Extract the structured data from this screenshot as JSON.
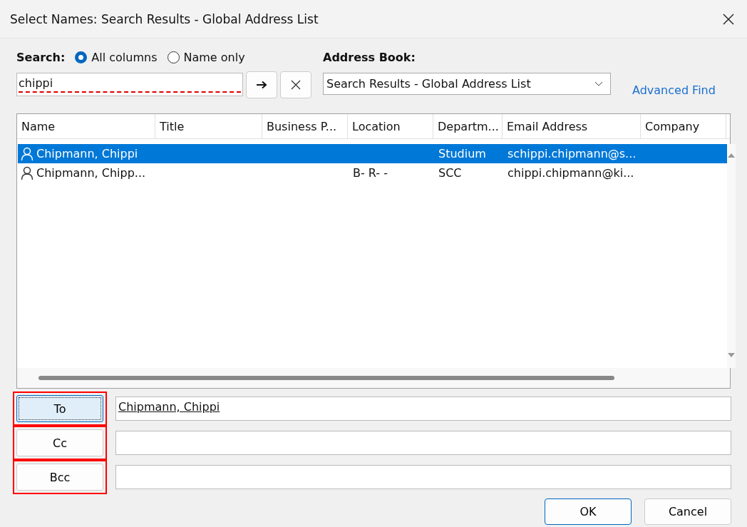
{
  "window": {
    "title": "Select Names: Search Results - Global Address List"
  },
  "search": {
    "label": "Search:",
    "value": "chippi",
    "misspelled": true,
    "options": [
      {
        "label": "All columns",
        "selected": true
      },
      {
        "label": "Name only",
        "selected": false
      }
    ]
  },
  "address_book": {
    "label": "Address Book:",
    "value": "Search Results - Global Address List"
  },
  "advanced_find": "Advanced Find",
  "table": {
    "columns": [
      "Name",
      "Title",
      "Business P...",
      "Location",
      "Departm...",
      "Email Address",
      "Company"
    ],
    "rows": [
      {
        "selected": true,
        "cells": [
          "Chipmann, Chippi",
          null,
          null,
          null,
          "Studium",
          "schippi.chipmann@s...",
          null
        ]
      },
      {
        "selected": false,
        "cells": [
          "Chipmann, Chipp...",
          null,
          null,
          "B- R- -",
          "SCC",
          "chippi.chipmann@ki...",
          null
        ]
      }
    ]
  },
  "recipients": [
    {
      "button": "To",
      "value": "Chipmann, Chippi",
      "focused": true,
      "highlighted": true
    },
    {
      "button": "Cc",
      "focused": false,
      "highlighted": true
    },
    {
      "button": "Bcc",
      "focused": false,
      "highlighted": true
    }
  ],
  "buttons": [
    {
      "label": "OK",
      "default": true
    },
    {
      "label": "Cancel",
      "default": false
    }
  ]
}
